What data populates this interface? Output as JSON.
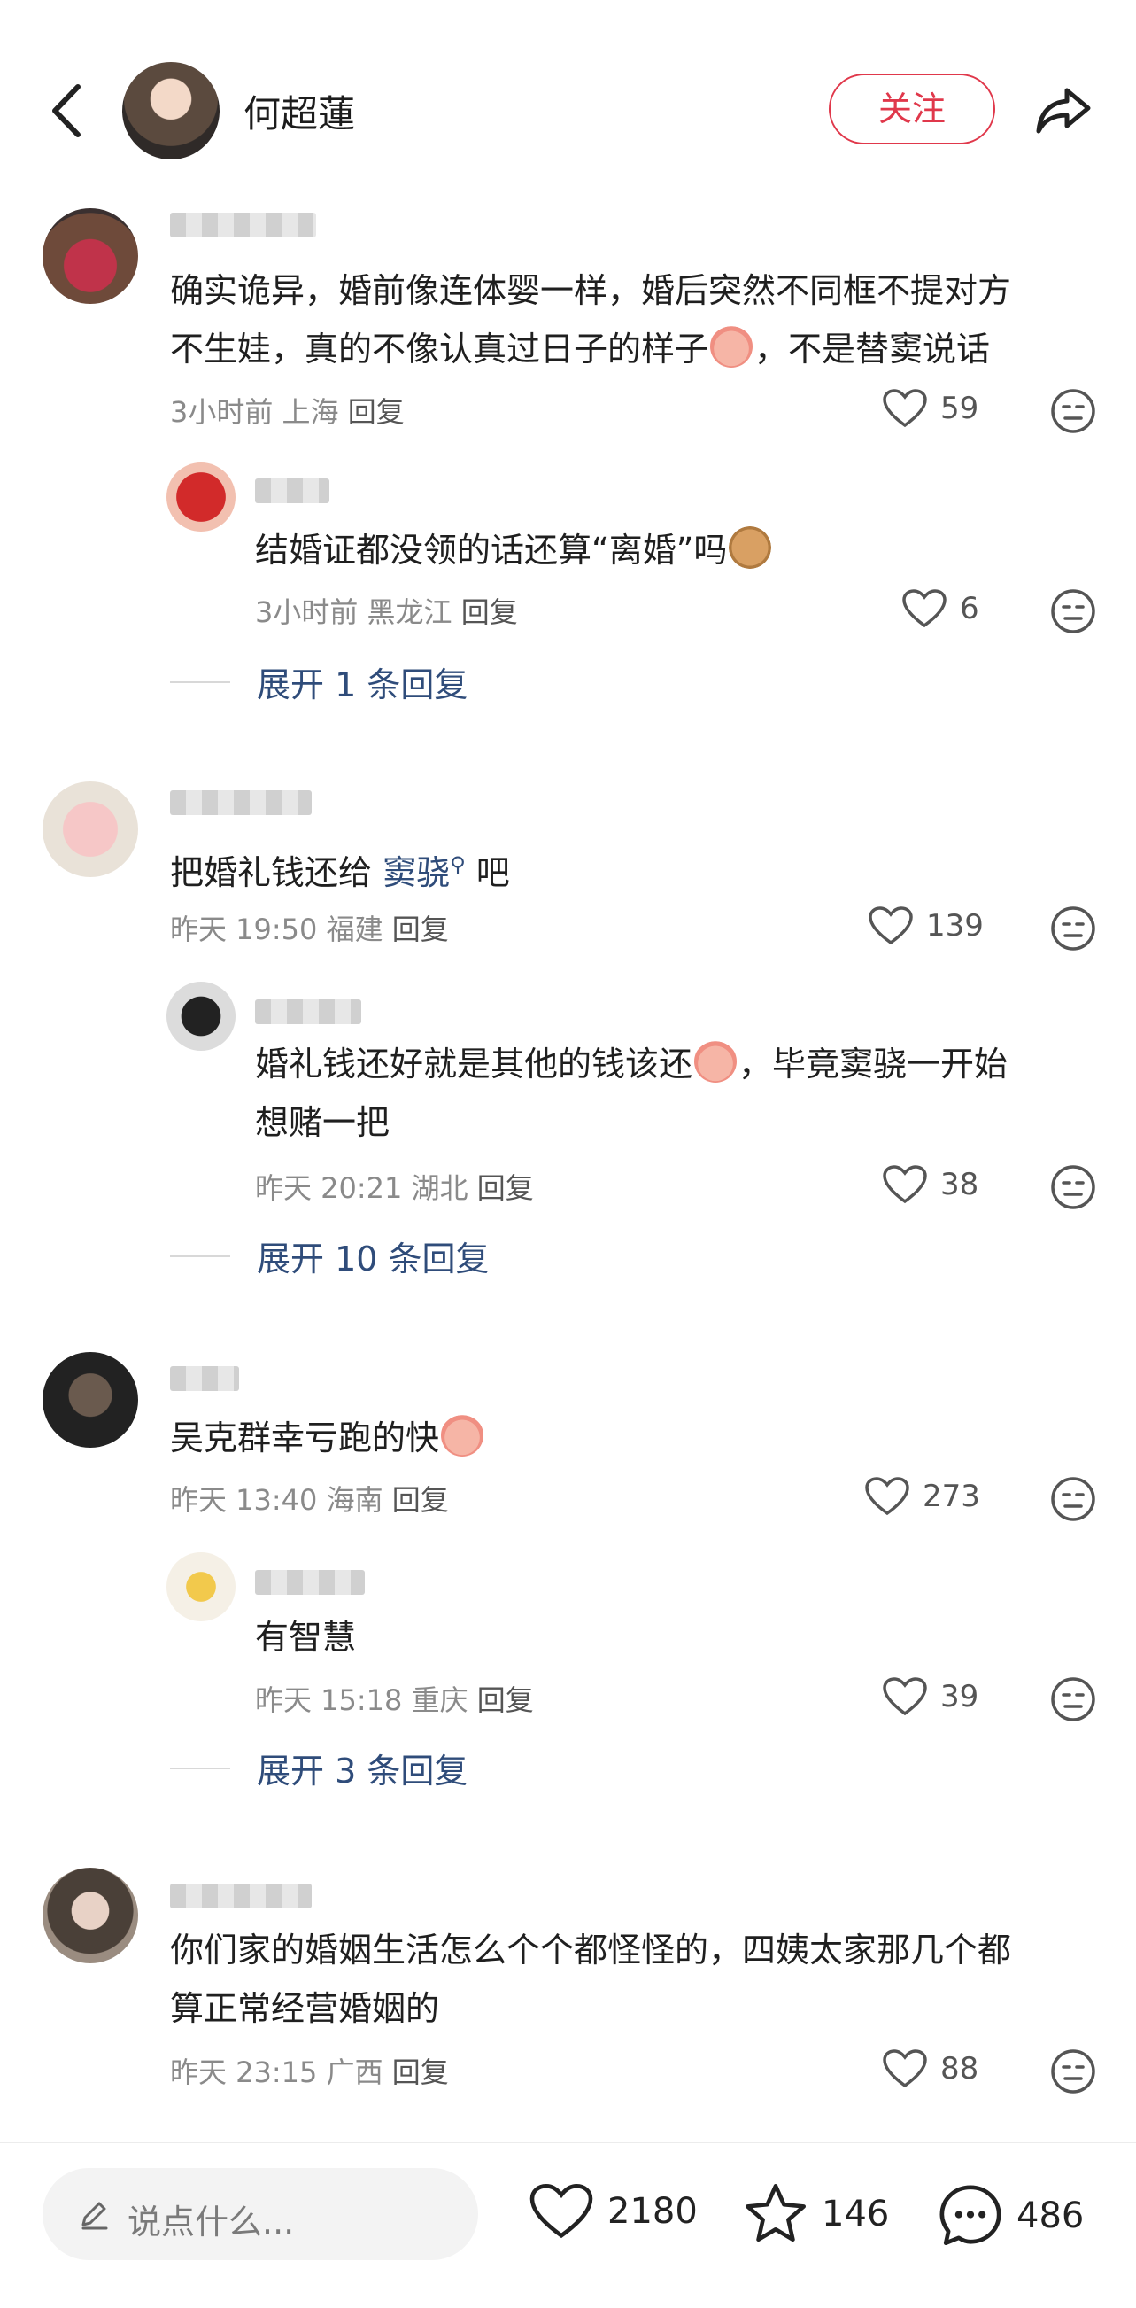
{
  "header": {
    "title": "何超蓮",
    "follow_label": "关注"
  },
  "comments": [
    {
      "text_line1": "确实诡异，婚前像连体婴一样，婚后突然不同框不提对方",
      "text_line2": "不生娃，真的不像认真过日子的样子",
      "text_tail": "，不是替窦说话",
      "time": "3小时前",
      "location": "上海",
      "reply_label": "回复",
      "likes": "59",
      "replies": [
        {
          "text": "结婚证都没领的话还算“离婚”吗",
          "time": "3小时前",
          "location": "黑龙江",
          "reply_label": "回复",
          "likes": "6"
        }
      ],
      "expand_label": "展开 1 条回复"
    },
    {
      "text_before": "把婚礼钱还给 ",
      "mention": "窦骁",
      "text_after": " 吧",
      "time": "昨天 19:50",
      "location": "福建",
      "reply_label": "回复",
      "likes": "139",
      "replies": [
        {
          "text_line1": "婚礼钱还好就是其他的钱该还",
          "text_line1_tail": "，毕竟窦骁一开始",
          "text_line2": "想赌一把",
          "time": "昨天 20:21",
          "location": "湖北",
          "reply_label": "回复",
          "likes": "38"
        }
      ],
      "expand_label": "展开 10 条回复"
    },
    {
      "text": "吴克群幸亏跑的快",
      "time": "昨天 13:40",
      "location": "海南",
      "reply_label": "回复",
      "likes": "273",
      "replies": [
        {
          "text": "有智慧",
          "time": "昨天 15:18",
          "location": "重庆",
          "reply_label": "回复",
          "likes": "39"
        }
      ],
      "expand_label": "展开 3 条回复"
    },
    {
      "text_line1": "你们家的婚姻生活怎么个个都怪怪的，四姨太家那几个都",
      "text_line2": "算正常经营婚姻的",
      "time": "昨天 23:15",
      "location": "广西",
      "reply_label": "回复",
      "likes": "88"
    }
  ],
  "bottom_bar": {
    "input_placeholder": "说点什么...",
    "likes": "2180",
    "favorites": "146",
    "comments": "486"
  },
  "colors": {
    "accent": "#e0384b",
    "link": "#2f4c7a",
    "muted": "#8a8a8a"
  },
  "icons": [
    "back-icon",
    "share-icon",
    "heart-icon",
    "dislike-face-icon",
    "pencil-icon",
    "star-icon",
    "chat-icon",
    "cry-emoji",
    "dog-emoji"
  ]
}
